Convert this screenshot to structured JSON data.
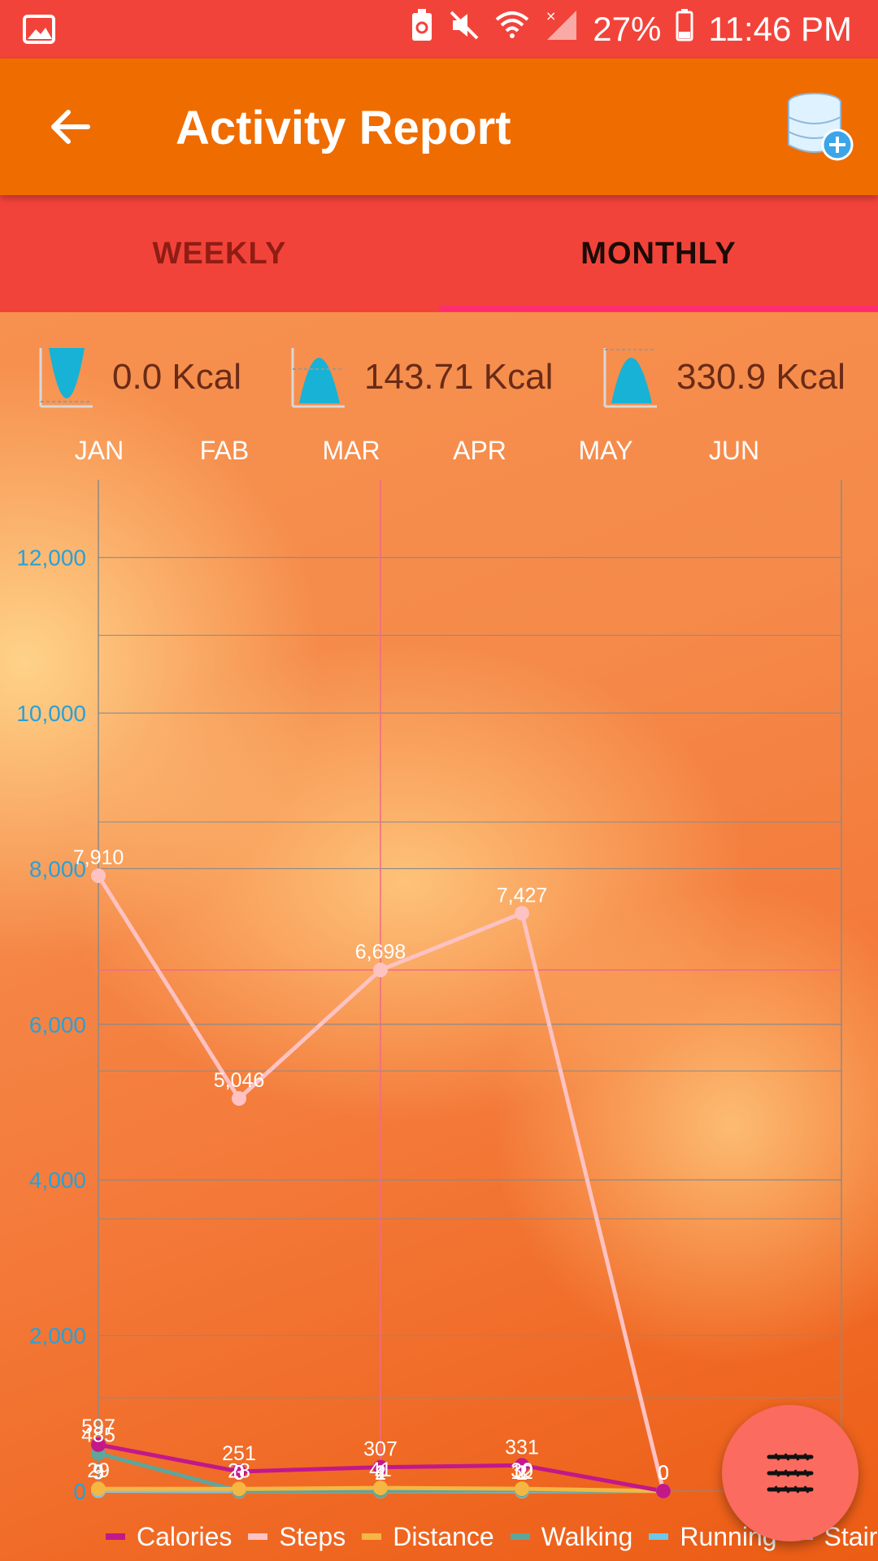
{
  "status_bar": {
    "battery": "27%",
    "time": "11:46 PM",
    "icons": [
      "image-icon",
      "battery-saver-icon",
      "mute-icon",
      "wifi-icon",
      "signal-icon",
      "battery-icon"
    ]
  },
  "app_bar": {
    "title": "Activity Report",
    "back_icon": "arrow-left-icon",
    "action_icon": "database-add-icon"
  },
  "tabs": [
    {
      "label": "WEEKLY",
      "selected": false
    },
    {
      "label": "MONTHLY",
      "selected": true
    }
  ],
  "summary": [
    {
      "icon": "min-curve-icon",
      "value": "0.0 Kcal"
    },
    {
      "icon": "avg-curve-icon",
      "value": "143.71 Kcal"
    },
    {
      "icon": "max-curve-icon",
      "value": "330.9 Kcal"
    }
  ],
  "months": [
    "JAN",
    "FAB",
    "MAR",
    "APR",
    "MAY",
    "JUN"
  ],
  "chart_data": {
    "type": "line",
    "x": [
      "JAN",
      "FAB",
      "MAR",
      "APR",
      "MAY"
    ],
    "ylim": [
      0,
      13000
    ],
    "yticks": [
      "0",
      "2,000",
      "4,000",
      "6,000",
      "8,000",
      "10,000",
      "12,000"
    ],
    "ytick_values": [
      0,
      2000,
      4000,
      6000,
      8000,
      10000,
      12000
    ],
    "grid": true,
    "series": [
      {
        "name": "Calories",
        "color": "#c2188a",
        "values": [
          597,
          251,
          307,
          331,
          0
        ],
        "labels": [
          "597",
          "251",
          "307",
          "331",
          "0"
        ]
      },
      {
        "name": "Steps",
        "color": "#ffc2c2",
        "values": [
          7910,
          5046,
          6698,
          7427,
          0
        ],
        "labels": [
          "7,910",
          "5,046",
          "6,698",
          "7,427",
          "0"
        ]
      },
      {
        "name": "Distance",
        "color": "#f5b642",
        "values": [
          29,
          28,
          41,
          30,
          0
        ],
        "labels": [
          "29",
          "28",
          "41",
          "30",
          "0"
        ]
      },
      {
        "name": "Walking",
        "color": "#5fa59a",
        "values": [
          485,
          3,
          4,
          12,
          0
        ],
        "labels": [
          "485",
          "3",
          "4",
          "12",
          "0"
        ]
      },
      {
        "name": "Running",
        "color": "#6fc6e8",
        "values": [
          9,
          0,
          2,
          2,
          0
        ],
        "labels": [
          "9",
          "0",
          "2",
          "2",
          "0"
        ]
      },
      {
        "name": "Stairs",
        "color": "#c9c6f2",
        "values": [
          5,
          0,
          1,
          1,
          0
        ],
        "labels": [
          "5",
          "0",
          "1",
          "1",
          "0"
        ]
      }
    ]
  },
  "legend": [
    "Calories",
    "Steps",
    "Distance",
    "Walking",
    "Running",
    "Stairs"
  ],
  "fab": {
    "icon": "filter-lines-icon"
  }
}
